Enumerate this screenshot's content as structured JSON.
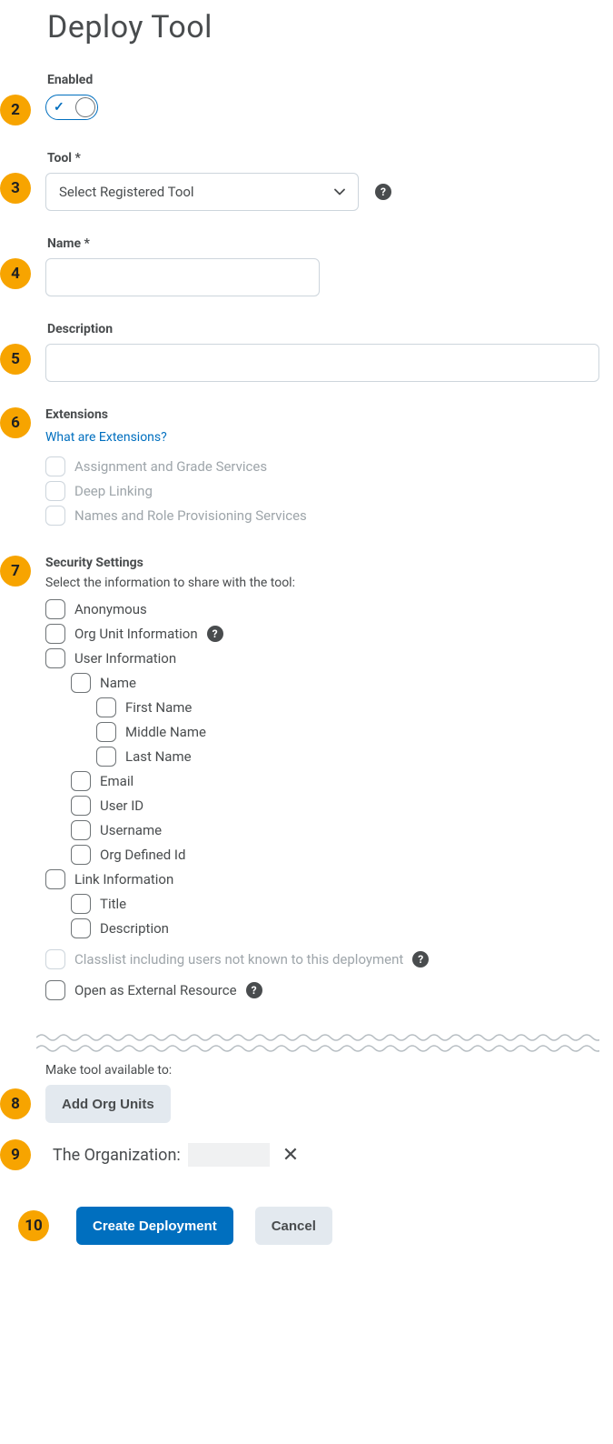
{
  "page": {
    "title": "Deploy Tool"
  },
  "steps": {
    "s2": "2",
    "s3": "3",
    "s4": "4",
    "s5": "5",
    "s6": "6",
    "s7": "7",
    "s8": "8",
    "s9": "9",
    "s10": "10"
  },
  "enabled": {
    "label": "Enabled"
  },
  "tool": {
    "label": "Tool *",
    "placeholder": "Select Registered Tool"
  },
  "name": {
    "label": "Name *"
  },
  "description": {
    "label": "Description"
  },
  "extensions": {
    "label": "Extensions",
    "link": "What are Extensions?",
    "items": {
      "ags": "Assignment and Grade Services",
      "dl": "Deep Linking",
      "nrps": "Names and Role Provisioning Services"
    }
  },
  "security": {
    "label": "Security Settings",
    "helper": "Select the information to share with the tool:",
    "anonymous": "Anonymous",
    "orgunit": "Org Unit Information",
    "userinfo": "User Information",
    "uname": "Name",
    "first": "First Name",
    "middle": "Middle Name",
    "last": "Last Name",
    "email": "Email",
    "userid": "User ID",
    "username": "Username",
    "orgdef": "Org Defined Id",
    "linkinfo": "Link Information",
    "ltitle": "Title",
    "ldesc": "Description",
    "classlist": "Classlist including users not known to this deployment",
    "openext": "Open as External Resource"
  },
  "orgunits": {
    "label": "Make tool available to:",
    "addBtn": "Add Org Units",
    "orgLabel": "The Organization:"
  },
  "actions": {
    "create": "Create Deployment",
    "cancel": "Cancel"
  }
}
